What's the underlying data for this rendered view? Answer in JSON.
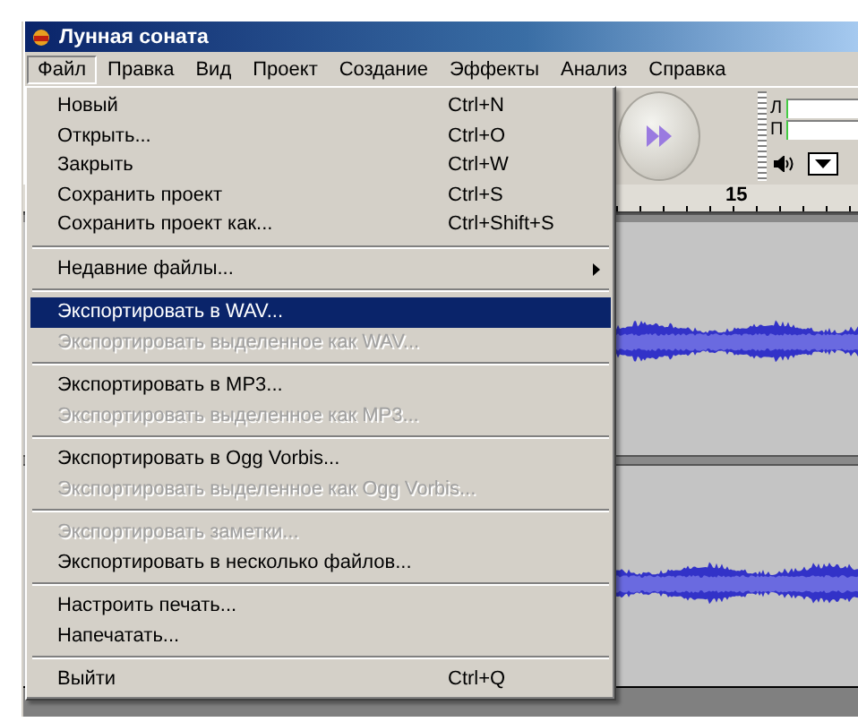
{
  "window": {
    "title": "Лунная соната"
  },
  "menubar": [
    {
      "label": "Файл",
      "selected": true
    },
    {
      "label": "Правка",
      "selected": false
    },
    {
      "label": "Вид",
      "selected": false
    },
    {
      "label": "Проект",
      "selected": false
    },
    {
      "label": "Создание",
      "selected": false
    },
    {
      "label": "Эффекты",
      "selected": false
    },
    {
      "label": "Анализ",
      "selected": false
    },
    {
      "label": "Справка",
      "selected": false
    }
  ],
  "file_menu": {
    "items": [
      {
        "kind": "item",
        "label": "Новый",
        "shortcut": "Ctrl+N",
        "disabled": false,
        "selected": false
      },
      {
        "kind": "item",
        "label": "Открыть...",
        "shortcut": "Ctrl+O",
        "disabled": false,
        "selected": false
      },
      {
        "kind": "item",
        "label": "Закрыть",
        "shortcut": "Ctrl+W",
        "disabled": false,
        "selected": false
      },
      {
        "kind": "item",
        "label": "Сохранить проект",
        "shortcut": "Ctrl+S",
        "disabled": false,
        "selected": false
      },
      {
        "kind": "item",
        "label": "Сохранить проект как...",
        "shortcut": "Ctrl+Shift+S",
        "disabled": false,
        "selected": false
      },
      {
        "kind": "separator"
      },
      {
        "kind": "submenu",
        "label": "Недавние файлы...",
        "disabled": false,
        "selected": false
      },
      {
        "kind": "separator"
      },
      {
        "kind": "item",
        "label": "Экспортировать в WAV...",
        "disabled": false,
        "selected": true
      },
      {
        "kind": "item",
        "label": "Экспортировать выделенное как WAV...",
        "disabled": true,
        "selected": false
      },
      {
        "kind": "separator"
      },
      {
        "kind": "item",
        "label": "Экспортировать в MP3...",
        "disabled": false,
        "selected": false
      },
      {
        "kind": "item",
        "label": "Экспортировать выделенное как MP3...",
        "disabled": true,
        "selected": false
      },
      {
        "kind": "separator"
      },
      {
        "kind": "item",
        "label": "Экспортировать в Ogg Vorbis...",
        "disabled": false,
        "selected": false
      },
      {
        "kind": "item",
        "label": "Экспортировать выделенное как Ogg Vorbis...",
        "disabled": true,
        "selected": false
      },
      {
        "kind": "separator"
      },
      {
        "kind": "item",
        "label": "Экспортировать заметки...",
        "disabled": true,
        "selected": false
      },
      {
        "kind": "item",
        "label": "Экспортировать в несколько файлов...",
        "disabled": false,
        "selected": false
      },
      {
        "kind": "separator"
      },
      {
        "kind": "item",
        "label": "Настроить печать...",
        "disabled": false,
        "selected": false
      },
      {
        "kind": "item",
        "label": "Напечатать...",
        "disabled": false,
        "selected": false
      },
      {
        "kind": "separator"
      },
      {
        "kind": "item",
        "label": "Выйти",
        "shortcut": "Ctrl+Q",
        "disabled": false,
        "selected": false
      }
    ]
  },
  "meter": {
    "channels": [
      "Л",
      "П"
    ]
  },
  "ruler": {
    "labels": [
      "15"
    ]
  },
  "tracks": [
    {
      "kind": "waveform"
    },
    {
      "kind": "waveform"
    }
  ]
}
